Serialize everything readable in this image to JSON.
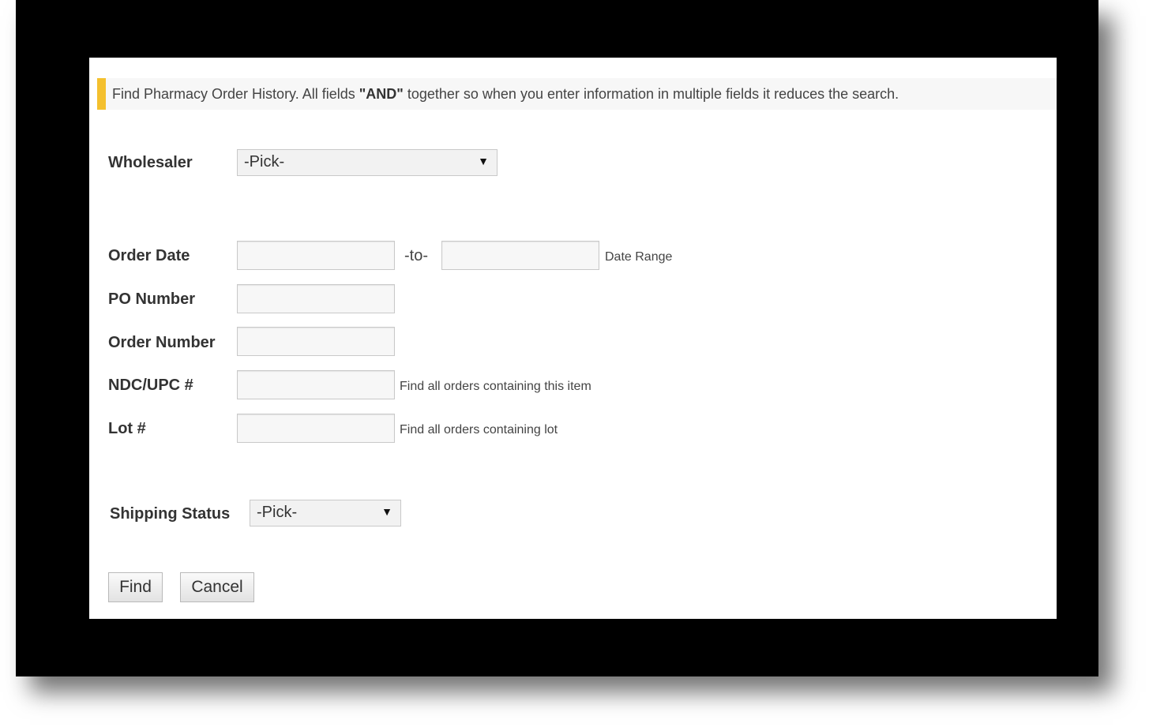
{
  "banner": {
    "text_before": "Find Pharmacy Order History. All fields ",
    "text_bold": "\"AND\"",
    "text_after": " together so when you enter information in multiple fields it reduces the search."
  },
  "form": {
    "wholesaler_label": "Wholesaler",
    "wholesaler_value": "-Pick-",
    "order_date_label": "Order Date",
    "order_date_from": "",
    "date_separator": "-to-",
    "order_date_to": "",
    "date_range_hint": "Date Range",
    "po_number_label": "PO Number",
    "po_number_value": "",
    "order_number_label": "Order Number",
    "order_number_value": "",
    "ndc_label": "NDC/UPC #",
    "ndc_value": "",
    "ndc_hint": "Find all orders containing this item",
    "lot_label": "Lot #",
    "lot_value": "",
    "lot_hint": "Find all orders containing lot",
    "shipping_status_label": "Shipping Status",
    "shipping_status_value": "-Pick-"
  },
  "buttons": {
    "find": "Find",
    "cancel": "Cancel"
  },
  "icons": {
    "dropdown": "chevron-down-icon"
  },
  "colors": {
    "accent": "#f4c02e",
    "frame": "#000000"
  }
}
